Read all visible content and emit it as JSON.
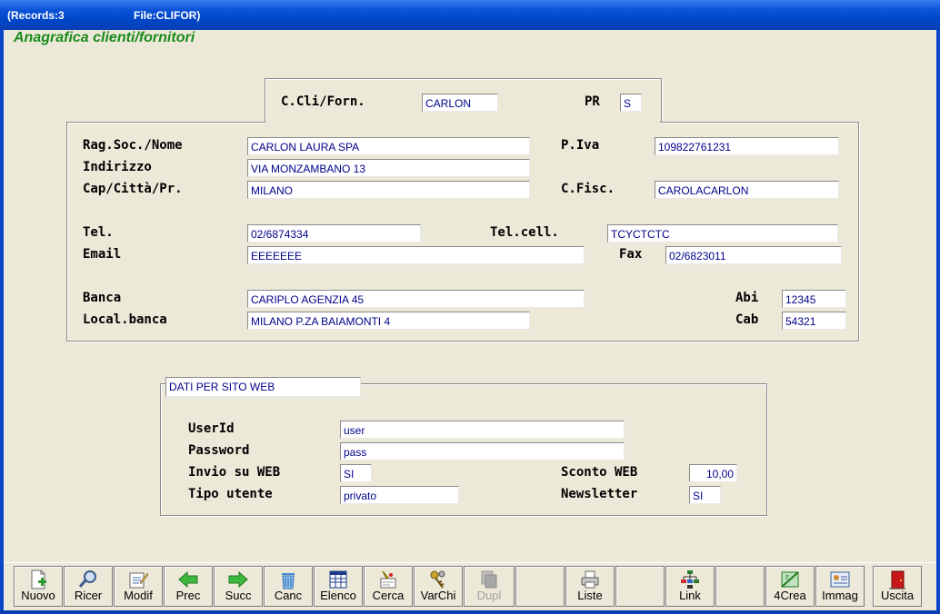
{
  "titlebar": {
    "records": "(Records:3",
    "file": "File:CLIFOR)"
  },
  "form_title": "Anagrafica clienti/fornitori",
  "header_box": {
    "code_label": "C.Cli/Forn.",
    "code_value": "CARLON",
    "pr_label": "PR",
    "pr_value": "S"
  },
  "main": {
    "ragsoc_label": "Rag.Soc./Nome",
    "ragsoc_value": "CARLON LAURA SPA",
    "piva_label": "P.Iva",
    "piva_value": "109822761231",
    "indirizzo_label": "Indirizzo",
    "indirizzo_value": "VIA MONZAMBANO 13",
    "cap_label": "Cap/Città/Pr.",
    "cap_value": "MILANO",
    "cfisc_label": "C.Fisc.",
    "cfisc_value": "CAROLACARLON",
    "tel_label": "Tel.",
    "tel_value": "02/6874334",
    "cell_label": "Tel.cell.",
    "cell_value": "TCYCTCTC",
    "email_label": "Email",
    "email_value": "EEEEEEE",
    "fax_label": "Fax",
    "fax_value": "02/6823011",
    "banca_label": "Banca",
    "banca_value": "CARIPLO AGENZIA 45",
    "abi_label": "Abi",
    "abi_value": "12345",
    "localbanca_label": "Local.banca",
    "localbanca_value": "MILANO P.ZA BAIAMONTI 4",
    "cab_label": "Cab",
    "cab_value": "54321"
  },
  "web": {
    "group_title": "DATI PER SITO WEB",
    "userid_label": "UserId",
    "userid_value": "user",
    "password_label": "Password",
    "password_value": "pass",
    "invio_label": "Invio su WEB",
    "invio_value": "SI",
    "sconto_label": "Sconto WEB",
    "sconto_value": "10,00",
    "tipo_label": "Tipo utente",
    "tipo_value": "privato",
    "newsletter_label": "Newsletter",
    "newsletter_value": "SI"
  },
  "toolbar": [
    {
      "label": "Nuovo",
      "icon": "new-document-icon"
    },
    {
      "label": "Ricer",
      "icon": "magnifier-icon"
    },
    {
      "label": "Modif",
      "icon": "edit-document-icon"
    },
    {
      "label": "Prec",
      "icon": "arrow-left-icon"
    },
    {
      "label": "Succ",
      "icon": "arrow-right-icon"
    },
    {
      "label": "Canc",
      "icon": "trash-icon"
    },
    {
      "label": "Elenco",
      "icon": "table-list-icon"
    },
    {
      "label": "Cerca",
      "icon": "search-highlight-icon"
    },
    {
      "label": "VarChi",
      "icon": "keys-icon"
    },
    {
      "label": "Dupl",
      "icon": "duplicate-icon"
    },
    {
      "label": "",
      "icon": ""
    },
    {
      "label": "Liste",
      "icon": "printer-icon"
    },
    {
      "label": "",
      "icon": ""
    },
    {
      "label": "Link",
      "icon": "link-tree-icon"
    },
    {
      "label": "",
      "icon": ""
    },
    {
      "label": "4Crea",
      "icon": "create-icon"
    },
    {
      "label": "Immag",
      "icon": "image-card-icon"
    },
    {
      "label": "Uscita",
      "icon": "exit-door-icon"
    }
  ]
}
